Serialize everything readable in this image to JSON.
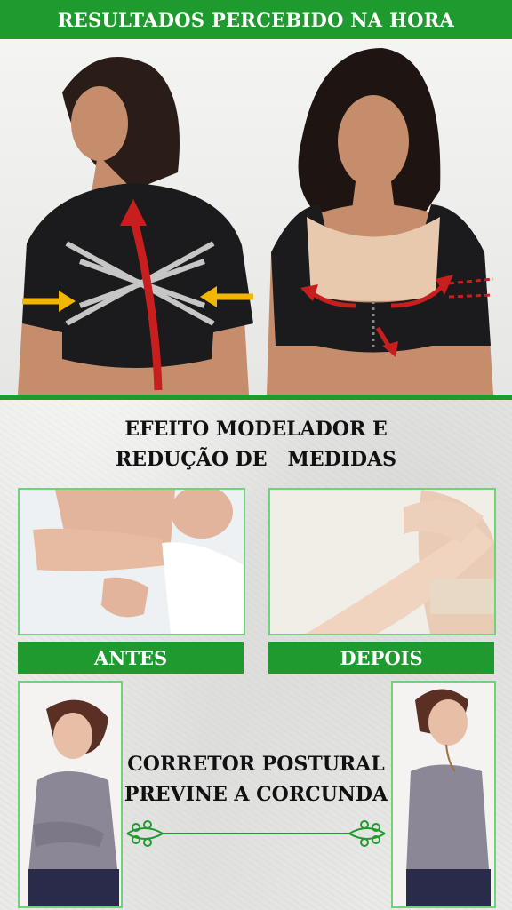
{
  "banner": {
    "title": "RESULTADOS PERCEBIDO NA HORA"
  },
  "section_modeling": {
    "line1": "EFEITO MODELADOR E",
    "line2": "REDUÇÃO DE   MEDIDAS"
  },
  "comparison": {
    "before_label": "ANTES",
    "after_label": "DEPOIS"
  },
  "section_posture": {
    "line1": "CORRETOR POSTURAL",
    "line2": "PREVINE A CORCUNDA"
  },
  "colors": {
    "brand_green": "#1f9a2e",
    "frame_green": "#6fd37c",
    "arrow_red": "#c81e1e",
    "arrow_yellow": "#f2b705"
  }
}
